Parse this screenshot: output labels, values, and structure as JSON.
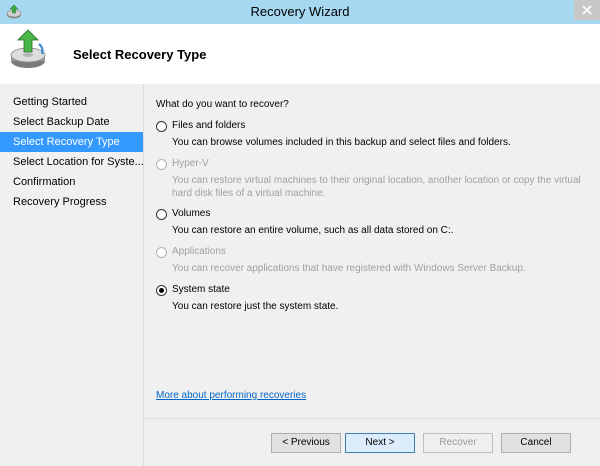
{
  "window": {
    "title": "Recovery Wizard"
  },
  "header": {
    "title": "Select Recovery Type"
  },
  "sidebar": {
    "steps": [
      {
        "label": "Getting Started"
      },
      {
        "label": "Select Backup Date"
      },
      {
        "label": "Select Recovery Type"
      },
      {
        "label": "Select Location for Syste..."
      },
      {
        "label": "Confirmation"
      },
      {
        "label": "Recovery Progress"
      }
    ],
    "active_index": 2
  },
  "content": {
    "question": "What do you want to recover?",
    "options": [
      {
        "label": "Files and folders",
        "description": "You can browse volumes included in this backup and select files and folders.",
        "enabled": true,
        "selected": false
      },
      {
        "label": "Hyper-V",
        "description": "You can restore virtual machines to their original location, another location or copy the virtual hard disk files of a virtual machine.",
        "enabled": false,
        "selected": false
      },
      {
        "label": "Volumes",
        "description": "You can restore an entire volume, such as all data stored on C:.",
        "enabled": true,
        "selected": false
      },
      {
        "label": "Applications",
        "description": "You can recover applications that have registered with Windows Server Backup.",
        "enabled": false,
        "selected": false
      },
      {
        "label": "System state",
        "description": "You can restore just the system state.",
        "enabled": true,
        "selected": true
      }
    ],
    "more_link": "More about performing recoveries"
  },
  "footer": {
    "previous_label": "< Previous",
    "next_label": "Next >",
    "recover_label": "Recover",
    "cancel_label": "Cancel"
  },
  "icons": {
    "app": "backup-icon",
    "header": "backup-restore-icon",
    "close": "close-icon"
  },
  "colors": {
    "titlebar": "#a6d8f2",
    "active_step": "#3399ff",
    "link": "#0066cc",
    "panel": "#f0f0f0"
  }
}
